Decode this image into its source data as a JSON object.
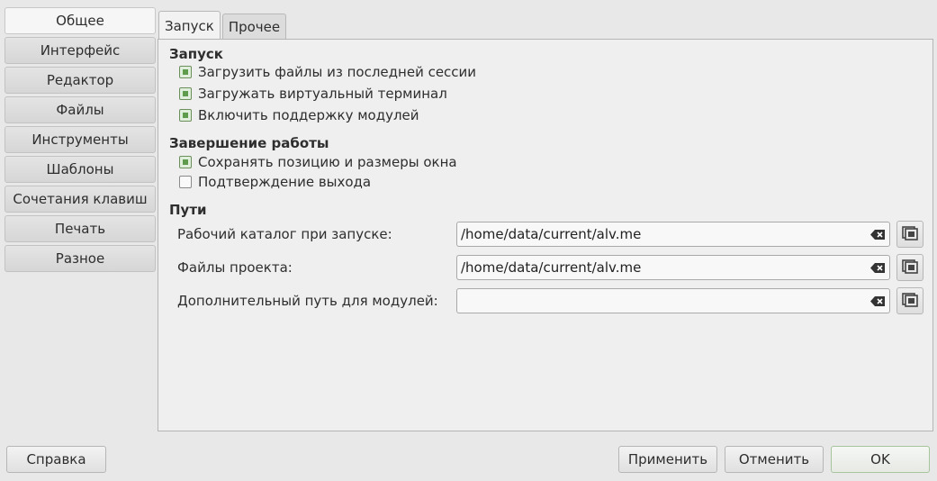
{
  "sidebar": {
    "items": [
      {
        "label": "Общее"
      },
      {
        "label": "Интерфейс"
      },
      {
        "label": "Редактор"
      },
      {
        "label": "Файлы"
      },
      {
        "label": "Инструменты"
      },
      {
        "label": "Шаблоны"
      },
      {
        "label": "Сочетания клавиш"
      },
      {
        "label": "Печать"
      },
      {
        "label": "Разное"
      }
    ],
    "selected": "Общее"
  },
  "tabs": [
    {
      "label": "Запуск"
    },
    {
      "label": "Прочее"
    }
  ],
  "startup": {
    "title": "Запуск",
    "load_session": {
      "label": "Загрузить файлы из последней сессии",
      "checked": true
    },
    "load_terminal": {
      "label": "Загружать виртуальный терминал",
      "checked": true
    },
    "enable_plugins": {
      "label": "Включить поддержку модулей",
      "checked": true
    }
  },
  "shutdown": {
    "title": "Завершение работы",
    "save_geometry": {
      "label": "Сохранять позицию и размеры окна",
      "checked": true
    },
    "confirm_exit": {
      "label": "Подтверждение выхода",
      "checked": false
    }
  },
  "paths": {
    "title": "Пути",
    "startup_dir": {
      "label": "Рабочий каталог при запуске:",
      "value": "/home/data/current/alv.me"
    },
    "project_files": {
      "label": "Файлы проекта:",
      "value": "/home/data/current/alv.me"
    },
    "plugins_path": {
      "label": "Дополнительный путь для модулей:",
      "value": ""
    }
  },
  "buttons": {
    "help": "Справка",
    "apply": "Применить",
    "cancel": "Отменить",
    "ok": "OK"
  }
}
